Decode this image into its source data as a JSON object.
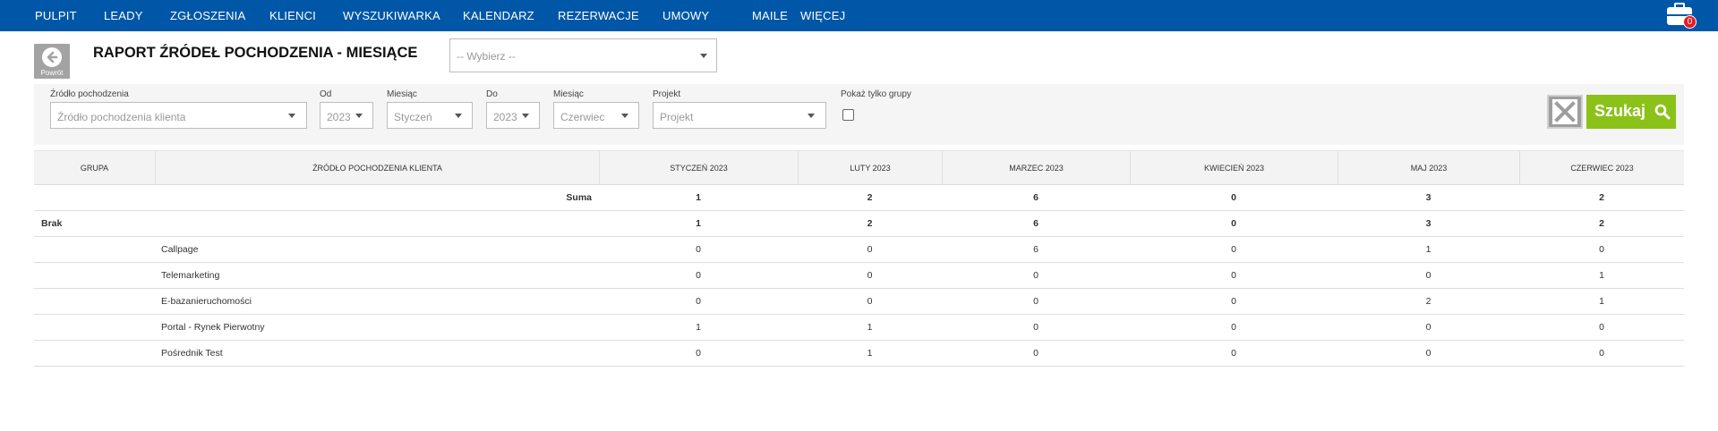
{
  "nav": {
    "items": [
      "PULPIT",
      "LEADY",
      "ZGŁOSZENIA",
      "KLIENCI",
      "WYSZUKIWARKA",
      "KALENDARZ",
      "REZERWACJE",
      "UMOWY",
      "MAILE",
      "WIĘCEJ"
    ],
    "notification_count": "0"
  },
  "header": {
    "back_label": "Powrót",
    "title": "RAPORT ŹRÓDEŁ POCHODZENIA - MIESIĄCE",
    "select_value": "-- Wybierz --"
  },
  "filters": {
    "source": {
      "label": "Źródło pochodzenia",
      "value": "Źródło pochodzenia klienta"
    },
    "from_year": {
      "label": "Od",
      "value": "2023"
    },
    "from_month": {
      "label": "Miesiąc",
      "value": "Styczeń"
    },
    "to_year": {
      "label": "Do",
      "value": "2023"
    },
    "to_month": {
      "label": "Miesiąc",
      "value": "Czerwiec"
    },
    "project": {
      "label": "Projekt",
      "value": "Projekt"
    },
    "groups_only": {
      "label": "Pokaż tylko grupy",
      "checked": false
    },
    "search_label": "Szukaj"
  },
  "table": {
    "headers": [
      "GRUPA",
      "ŹRÓDŁO POCHODZENIA KLIENTA",
      "STYCZEŃ 2023",
      "LUTY 2023",
      "MARZEC 2023",
      "KWIECIEŃ 2023",
      "MAJ 2023",
      "CZERWIEC 2023"
    ],
    "rows": [
      {
        "group": "",
        "source": "Suma",
        "values": [
          "1",
          "2",
          "6",
          "0",
          "3",
          "2"
        ],
        "kind": "sum"
      },
      {
        "group": "Brak",
        "source": "",
        "values": [
          "1",
          "2",
          "6",
          "0",
          "3",
          "2"
        ],
        "kind": "group"
      },
      {
        "group": "",
        "source": "Callpage",
        "values": [
          "0",
          "0",
          "6",
          "0",
          "1",
          "0"
        ],
        "kind": "item"
      },
      {
        "group": "",
        "source": "Telemarketing",
        "values": [
          "0",
          "0",
          "0",
          "0",
          "0",
          "1"
        ],
        "kind": "item"
      },
      {
        "group": "",
        "source": "E-bazanieruchomości",
        "values": [
          "0",
          "0",
          "0",
          "0",
          "2",
          "1"
        ],
        "kind": "item"
      },
      {
        "group": "",
        "source": "Portal - Rynek Pierwotny",
        "values": [
          "1",
          "1",
          "0",
          "0",
          "0",
          "0"
        ],
        "kind": "item"
      },
      {
        "group": "",
        "source": "Pośrednik Test",
        "values": [
          "0",
          "1",
          "0",
          "0",
          "0",
          "0"
        ],
        "kind": "item"
      }
    ]
  }
}
